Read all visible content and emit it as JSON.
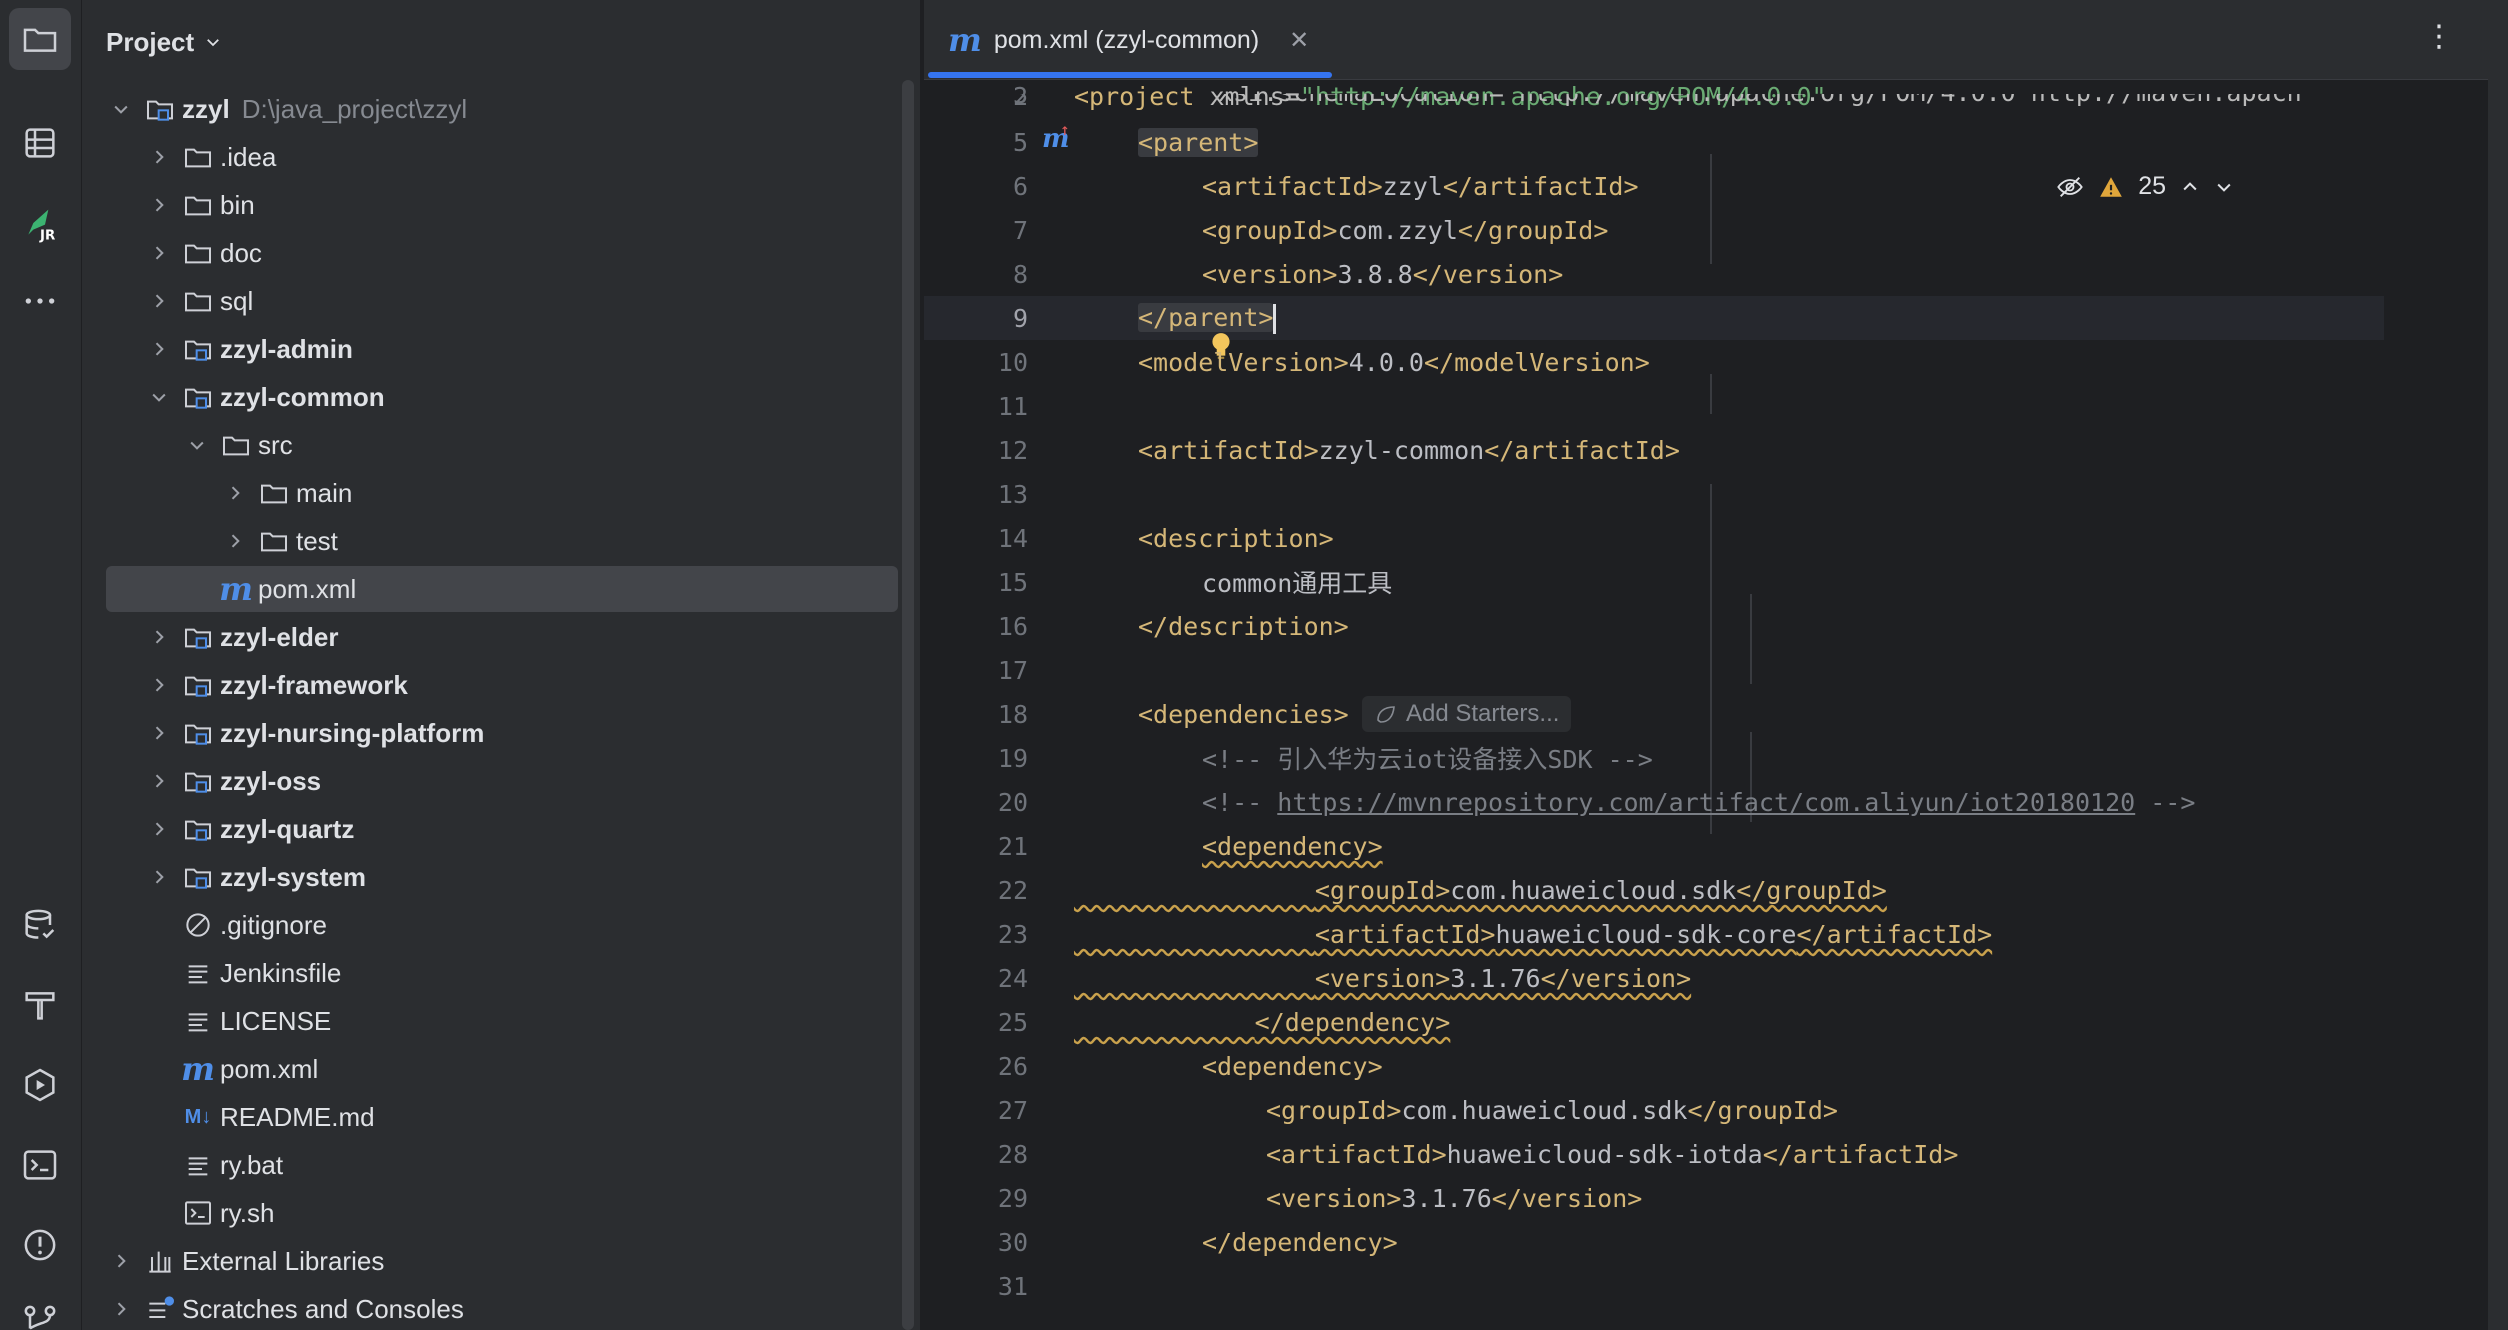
{
  "project_panel": {
    "title": "Project",
    "tree": [
      {
        "label": "zzyl",
        "path": "D:\\java_project\\zzyl",
        "icon": "module-folder-icon",
        "expanded": true,
        "bold": true
      },
      {
        "label": ".idea",
        "icon": "folder-icon"
      },
      {
        "label": "bin",
        "icon": "folder-icon"
      },
      {
        "label": "doc",
        "icon": "folder-icon"
      },
      {
        "label": "sql",
        "icon": "folder-icon"
      },
      {
        "label": "zzyl-admin",
        "icon": "module-folder-icon",
        "bold": true
      },
      {
        "label": "zzyl-common",
        "icon": "module-folder-icon",
        "bold": true,
        "expanded": true
      },
      {
        "label": "src",
        "icon": "folder-icon",
        "expanded": true
      },
      {
        "label": "main",
        "icon": "folder-icon"
      },
      {
        "label": "test",
        "icon": "folder-icon"
      },
      {
        "label": "pom.xml",
        "icon": "maven-icon",
        "selected": true
      },
      {
        "label": "zzyl-elder",
        "icon": "module-folder-icon",
        "bold": true
      },
      {
        "label": "zzyl-framework",
        "icon": "module-folder-icon",
        "bold": true
      },
      {
        "label": "zzyl-nursing-platform",
        "icon": "module-folder-icon",
        "bold": true
      },
      {
        "label": "zzyl-oss",
        "icon": "module-folder-icon",
        "bold": true
      },
      {
        "label": "zzyl-quartz",
        "icon": "module-folder-icon",
        "bold": true
      },
      {
        "label": "zzyl-system",
        "icon": "module-folder-icon",
        "bold": true
      },
      {
        "label": ".gitignore",
        "icon": "ignore-file-icon"
      },
      {
        "label": "Jenkinsfile",
        "icon": "text-file-icon"
      },
      {
        "label": "LICENSE",
        "icon": "text-file-icon"
      },
      {
        "label": "pom.xml",
        "icon": "maven-icon"
      },
      {
        "label": "README.md",
        "icon": "markdown-icon"
      },
      {
        "label": "ry.bat",
        "icon": "text-file-icon"
      },
      {
        "label": "ry.sh",
        "icon": "shell-script-icon"
      },
      {
        "label": "External Libraries",
        "icon": "library-icon"
      },
      {
        "label": "Scratches and Consoles",
        "icon": "scratches-icon"
      }
    ]
  },
  "editor": {
    "tab_label": "pom.xml (zzyl-common)",
    "tab_icon_text": "m",
    "md_icon_text": "M↓",
    "inspections": {
      "warnings": "25"
    },
    "add_starters_label": "Add Starters...",
    "line_numbers": [
      "2",
      "3",
      "5",
      "6",
      "7",
      "8",
      "9",
      "10",
      "11",
      "12",
      "13",
      "14",
      "15",
      "16",
      "17",
      "18",
      "19",
      "20",
      "21",
      "22",
      "23",
      "24",
      "25",
      "26",
      "27",
      "28",
      "29",
      "30",
      "31"
    ],
    "code": {
      "l2_open": "<project",
      "l2_attr": " xmlns=",
      "l2_val": "\"http://maven.apache.org/POM/4.0.0\"",
      "l3_partial": "xsi:schemaLocation=\"http://maven.apache.org/POM/4.0.0 http://maven.apach",
      "l5": "<parent>",
      "l6_open": "<artifactId>",
      "l6_text": "zzyl",
      "l6_close": "</artifactId>",
      "l7_open": "<groupId>",
      "l7_text": "com.zzyl",
      "l7_close": "</groupId>",
      "l8_open": "<version>",
      "l8_text": "3.8.8",
      "l8_close": "</version>",
      "l9": "</parent>",
      "l10_open": "<modelVersion>",
      "l10_text": "4.0.0",
      "l10_close": "</modelVersion>",
      "l12_open": "<artifactId>",
      "l12_text": "zzyl-common",
      "l12_close": "</artifactId>",
      "l14": "<description>",
      "l15": "common通用工具",
      "l16": "</description>",
      "l18": "<dependencies>",
      "l19": "<!-- 引入华为云iot设备接入SDK -->",
      "l20_pre": "<!-- ",
      "l20_url": "https://mvnrepository.com/artifact/com.aliyun/iot20180120",
      "l20_post": " -->",
      "l21": "<dependency>",
      "l22_open": "<groupId>",
      "l22_text": "com.huaweicloud.sdk",
      "l22_close": "</groupId>",
      "l23_open": "<artifactId>",
      "l23_text": "huaweicloud-sdk-core",
      "l23_close": "</artifactId>",
      "l24_open": "<version>",
      "l24_text": "3.1.76",
      "l24_close": "</version>",
      "l25": "</dependency>",
      "l26": "<dependency>",
      "l27_open": "<groupId>",
      "l27_text": "com.huaweicloud.sdk",
      "l27_close": "</groupId>",
      "l28_open": "<artifactId>",
      "l28_text": "huaweicloud-sdk-iotda",
      "l28_close": "</artifactId>",
      "l29_open": "<version>",
      "l29_text": "3.1.76",
      "l29_close": "</version>",
      "l30": "</dependency>"
    }
  },
  "colors": {
    "background": "#1e1f22",
    "panel": "#2b2d30",
    "accent": "#3574f0",
    "xml_tag": "#d5b778",
    "xml_string": "#6aab73",
    "comment": "#7a7e85",
    "warning": "#e0a63b"
  }
}
